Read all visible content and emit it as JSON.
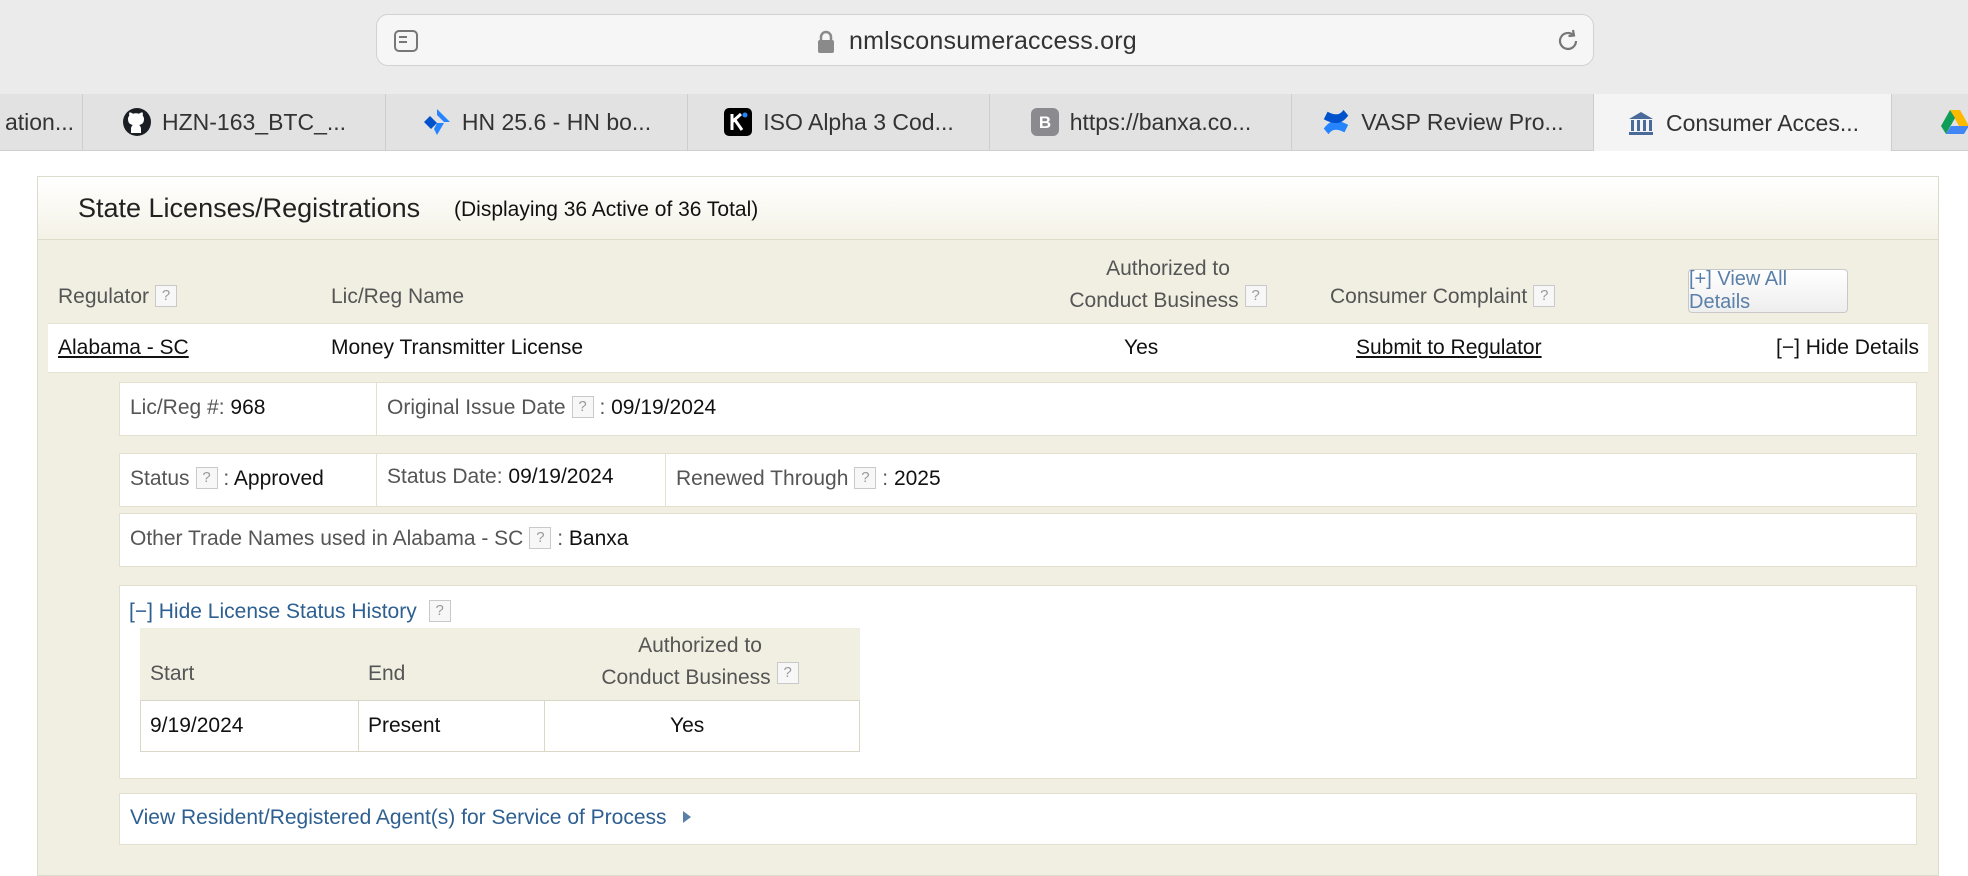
{
  "browser": {
    "url": "nmlsconsumeraccess.org",
    "tabs": [
      {
        "label": "ation...",
        "icon": "partial-tab-icon"
      },
      {
        "label": "HZN-163_BTC_...",
        "icon": "github-icon"
      },
      {
        "label": "HN 25.6 - HN bo...",
        "icon": "jira-icon"
      },
      {
        "label": "ISO Alpha 3 Cod...",
        "icon": "k-app-icon"
      },
      {
        "label": "https://banxa.co...",
        "icon": "b-letter-icon"
      },
      {
        "label": "VASP Review Pro...",
        "icon": "confluence-icon"
      },
      {
        "label": "Consumer Acces...",
        "icon": "bank-building-icon",
        "active": true
      },
      {
        "label": "",
        "icon": "google-drive-icon"
      }
    ]
  },
  "section": {
    "title": "State Licenses/Registrations",
    "subtitle": "(Displaying 36 Active of 36 Total)"
  },
  "columns": {
    "regulator": "Regulator",
    "lic_name": "Lic/Reg Name",
    "authorized_line1": "Authorized to",
    "authorized_line2": "Conduct Business",
    "complaint": "Consumer Complaint",
    "view_all": "[+] View All Details",
    "help_glyph": "?"
  },
  "license": {
    "regulator": "Alabama - SC",
    "name": "Money Transmitter License",
    "authorized": "Yes",
    "complaint_link": "Submit to Regulator",
    "hide_details": "[−] Hide Details"
  },
  "details": {
    "lic_no_label": "Lic/Reg #:",
    "lic_no": "968",
    "issue_label": "Original Issue Date",
    "issue_date": "09/19/2024",
    "status_label": "Status",
    "status": "Approved",
    "status_date_label": "Status Date:",
    "status_date": "09/19/2024",
    "renewed_label": "Renewed Through",
    "renewed": "2025",
    "trade_label": "Other Trade Names used in Alabama - SC",
    "trade_value": "Banxa",
    "colon": ":"
  },
  "history": {
    "toggle": "[−] Hide License Status History",
    "headers": {
      "start": "Start",
      "end": "End",
      "auth1": "Authorized to",
      "auth2": "Conduct Business"
    },
    "rows": [
      {
        "start": "9/19/2024",
        "end": "Present",
        "authorized": "Yes"
      }
    ]
  },
  "agents_link": "View Resident/Registered Agent(s) for Service of Process"
}
